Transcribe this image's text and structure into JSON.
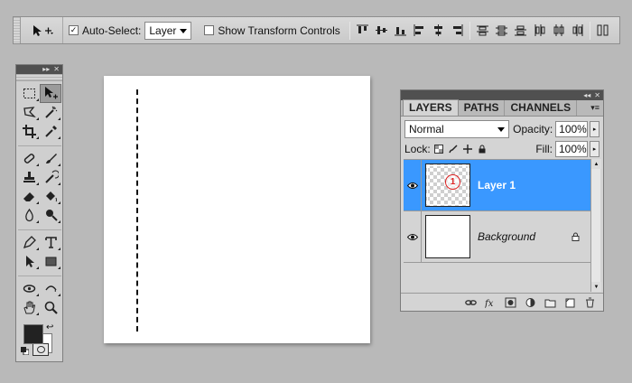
{
  "options_bar": {
    "auto_select_label": "Auto-Select:",
    "auto_select_checked": true,
    "auto_select_target": "Layer",
    "transform_label": "Show Transform Controls",
    "transform_checked": false
  },
  "canvas": {
    "background": "#ffffff"
  },
  "layers_panel": {
    "tabs": [
      {
        "label": "LAYERS",
        "active": true
      },
      {
        "label": "PATHS",
        "active": false
      },
      {
        "label": "CHANNELS",
        "active": false
      }
    ],
    "blend_mode": "Normal",
    "opacity_label": "Opacity:",
    "opacity_value": "100%",
    "lock_label": "Lock:",
    "fill_label": "Fill:",
    "fill_value": "100%",
    "layers": [
      {
        "name": "Layer 1",
        "selected": true,
        "visible": true,
        "marker": "1"
      },
      {
        "name": "Background",
        "selected": false,
        "visible": true,
        "locked": true
      }
    ]
  },
  "colors": {
    "selection": "#3a98ff",
    "foreground": "#222222",
    "background": "#ffffff"
  }
}
